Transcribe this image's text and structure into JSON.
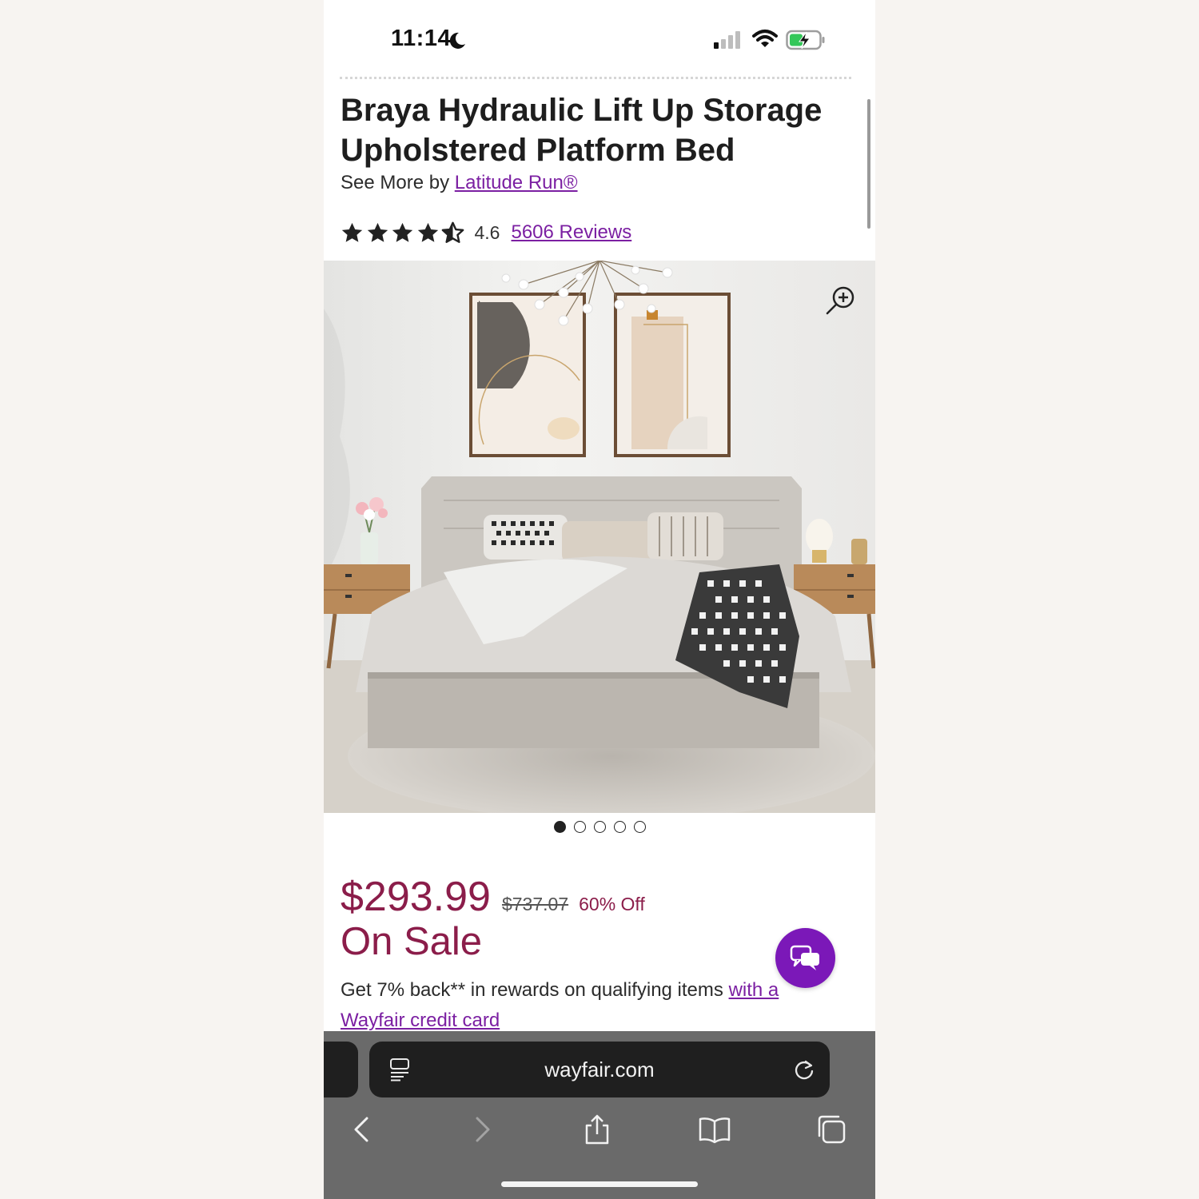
{
  "status_bar": {
    "time": "11:14"
  },
  "product": {
    "title": "Braya Hydraulic Lift Up Storage Upholstered Platform Bed",
    "see_more_prefix": "See More by",
    "brand": "Latitude Run®",
    "rating": "4.6",
    "stars": 4.5,
    "reviews": "5606 Reviews"
  },
  "gallery": {
    "image_count": 5,
    "active_index": 0
  },
  "pricing": {
    "sale_price": "$293.99",
    "original_price": "$737.07",
    "discount": "60% Off",
    "status": "On Sale",
    "rewards_text": "Get 7% back** in rewards on qualifying items",
    "rewards_link_1": "with a",
    "rewards_link_2": "Wayfair credit card"
  },
  "browser": {
    "address": "wayfair.com"
  },
  "colors": {
    "accent_purple": "#7b1fa2",
    "sale_red": "#8b1d4a",
    "chat_purple": "#7b18b8"
  },
  "icons": [
    "moon-icon",
    "signal-icon",
    "wifi-icon",
    "battery-icon",
    "star-icon",
    "zoom-in-icon",
    "chat-icon",
    "page-settings-icon",
    "reload-icon",
    "back-icon",
    "forward-icon",
    "share-icon",
    "bookmarks-icon",
    "tabs-icon"
  ]
}
